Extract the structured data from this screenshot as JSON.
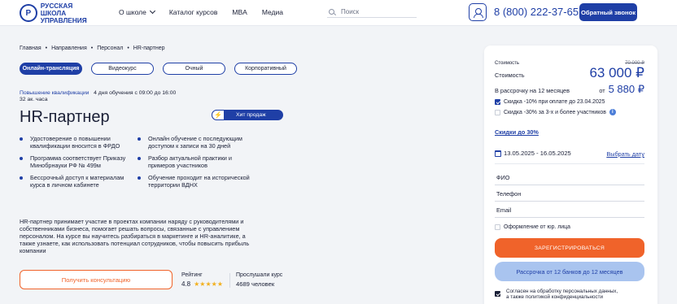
{
  "header": {
    "logo_mark": "Р",
    "logo_line1": "Русская школа",
    "logo_line2": "управления",
    "nav": [
      {
        "label": "О школе",
        "dropdown": true
      },
      {
        "label": "Каталог курсов",
        "dropdown": false
      },
      {
        "label": "MBA",
        "dropdown": false
      },
      {
        "label": "Медиа",
        "dropdown": false
      }
    ],
    "search_placeholder": "Поиск",
    "phone": "8 (800) 222-37-65",
    "callback_label": "Обратный звонок"
  },
  "breadcrumb": [
    "Главная",
    "Направления",
    "Персонал",
    "HR-партнер"
  ],
  "tabs": [
    {
      "label": "Онлайн-трансляция",
      "active": true
    },
    {
      "label": "Видеокурс",
      "active": false
    },
    {
      "label": "Очный",
      "active": false
    },
    {
      "label": "Корпоративный",
      "active": false
    }
  ],
  "meta": {
    "type": "Повышение квалификации",
    "duration": "4 дня обучения с 09:00 до 16:00",
    "hours": "32 ак. часа"
  },
  "title": "HR-партнер",
  "hit_badge": "Хит продаж",
  "features_left": [
    "Удостоверение о повышении квалификации вносится в ФРДО",
    "Программа соответствует Приказу Минобрнауки РФ № 499м",
    "Бессрочный доступ к материалам курса в личном кабинете"
  ],
  "features_right": [
    "Онлайн обучение с последующим доступом к записи на 30 дней",
    "Разбор актуальной практики и примеров участников",
    "Обучение проходит на исторической территории ВДНХ"
  ],
  "description": "HR-партнер принимает участие в проектах компании наряду с руководителями и собственниками бизнеса, помогает решать вопросы, связанные с управлением персоналом. На курсе вы научитесь разбираться в маркетинге и HR-аналитике, а также узнаете, как использовать потенциал сотрудников, чтобы повысить прибыль компании",
  "consult_label": "Получить консультацию",
  "rating": {
    "label": "Рейтинг",
    "value": "4.8",
    "stars": "★★★★★"
  },
  "listened": {
    "label": "Прослушали курс",
    "value": "4689 человек"
  },
  "card": {
    "old_label": "Стоимость",
    "old_price": "70 000 ₽",
    "price_label": "Стоимость",
    "price": "63 000 ₽",
    "installment_label": "В рассрочку на 12 месяцев",
    "installment_from": "от",
    "installment_price": "5 880 ₽",
    "discount1": "Скидка -10% при оплате до 23.04.2025",
    "discount2": "Скидка -30% за 3-х и более участников",
    "discounts_link": "Скидки до 30%",
    "dates": "13.05.2025 - 16.05.2025",
    "pick_date": "Выбрать дату",
    "fields": [
      "ФИО",
      "Телефон",
      "Email"
    ],
    "legal_label": "Оформление от юр. лица",
    "register_label": "Зарегистрироваться",
    "installment_button": "Рассрочка от 12 банков до 12 месяцев",
    "agree_line1": "Согласен на обработку персональных данных,",
    "agree_line2": "а также политикой конфиденциальности"
  }
}
